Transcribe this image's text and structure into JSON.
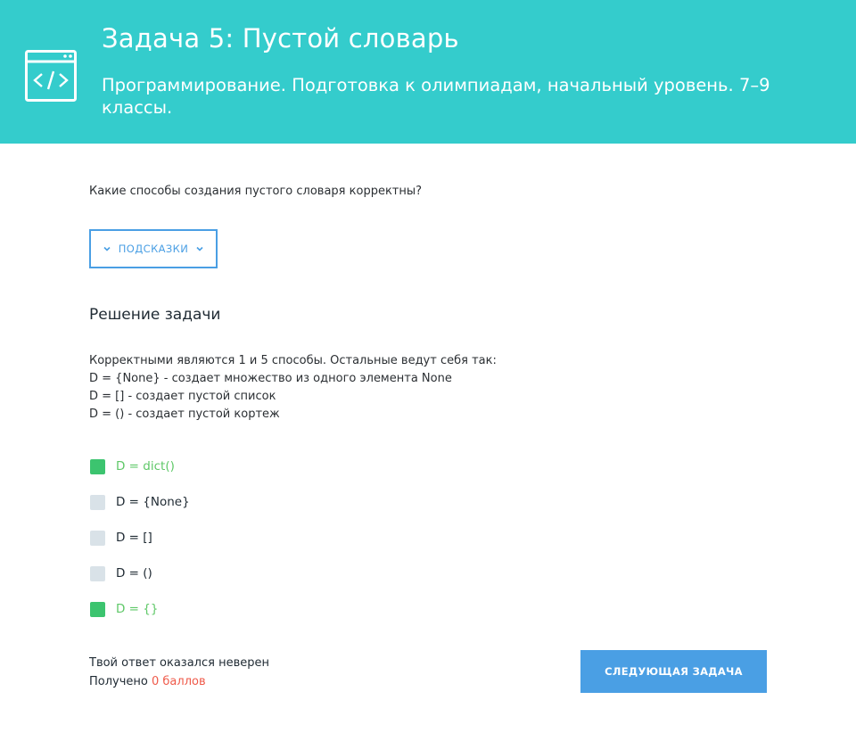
{
  "header": {
    "title": "Задача 5: Пустой словарь",
    "subtitle": "Программирование. Подготовка к олимпиадам, начальный уровень. 7–9 классы.",
    "icon": "code-window-icon",
    "background_color": "#34cccc"
  },
  "question": "Какие способы создания пустого словаря корректны?",
  "hints": {
    "label": "ПОДСКАЗКИ",
    "icon": "chevron-down-icon"
  },
  "solution": {
    "heading": "Решение задачи",
    "lines": [
      "Корректными являются 1 и 5 способы. Остальные ведут себя так:",
      "D = {None} - создает множество из одного элемента None",
      "D = [] - создает пустой список",
      "D = () - создает пустой кортеж"
    ]
  },
  "options": [
    {
      "label": "D = dict()",
      "correct": true
    },
    {
      "label": "D = {None}",
      "correct": false
    },
    {
      "label": "D = []",
      "correct": false
    },
    {
      "label": "D = ()",
      "correct": false
    },
    {
      "label": "D = {}",
      "correct": true
    }
  ],
  "result": {
    "message": "Твой ответ оказался неверен",
    "score_prefix": "Получено",
    "score_value": "0 баллов"
  },
  "next_button": {
    "label": "СЛЕДУЮЩАЯ ЗАДАЧА"
  },
  "colors": {
    "accent": "#4a9fe4",
    "correct": "#3cc46f",
    "error": "#ef5a4a"
  }
}
